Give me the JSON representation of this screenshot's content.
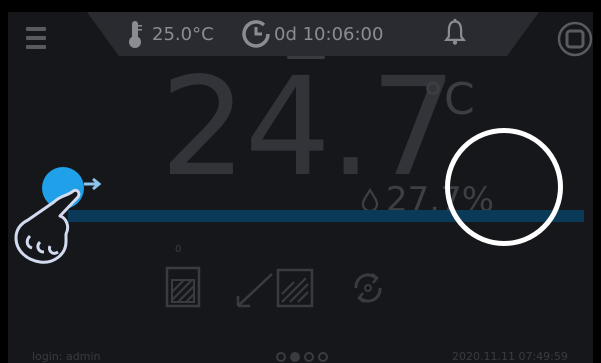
{
  "topbar": {
    "temperature_setpoint": "25.0°C",
    "timer": "0d 10:06:00"
  },
  "main": {
    "temperature_value": "24.7",
    "temperature_unit": "°C",
    "humidity_value": "27.7%",
    "program_step": "0"
  },
  "footer": {
    "login": "login: admin",
    "datetime": "2020.11.11 07:49:59",
    "pages": [
      {
        "active": false
      },
      {
        "active": true
      },
      {
        "active": false
      },
      {
        "active": false
      }
    ]
  },
  "icons": {
    "menu": "menu-icon",
    "thermometer": "thermometer-icon",
    "timer": "timer-icon",
    "bell": "bell-icon",
    "stop": "stop-icon",
    "drop": "humidity-drop-icon",
    "hand": "pointing-hand-icon",
    "program_1": "program-segment-icon",
    "program_2": "program-ramp-icon",
    "program_3": "program-loop-icon"
  },
  "colors": {
    "background": "#16171b",
    "accent": "#1fa0e8",
    "slider_track": "#0b3a59",
    "highlight_ring": "#ffffff"
  }
}
